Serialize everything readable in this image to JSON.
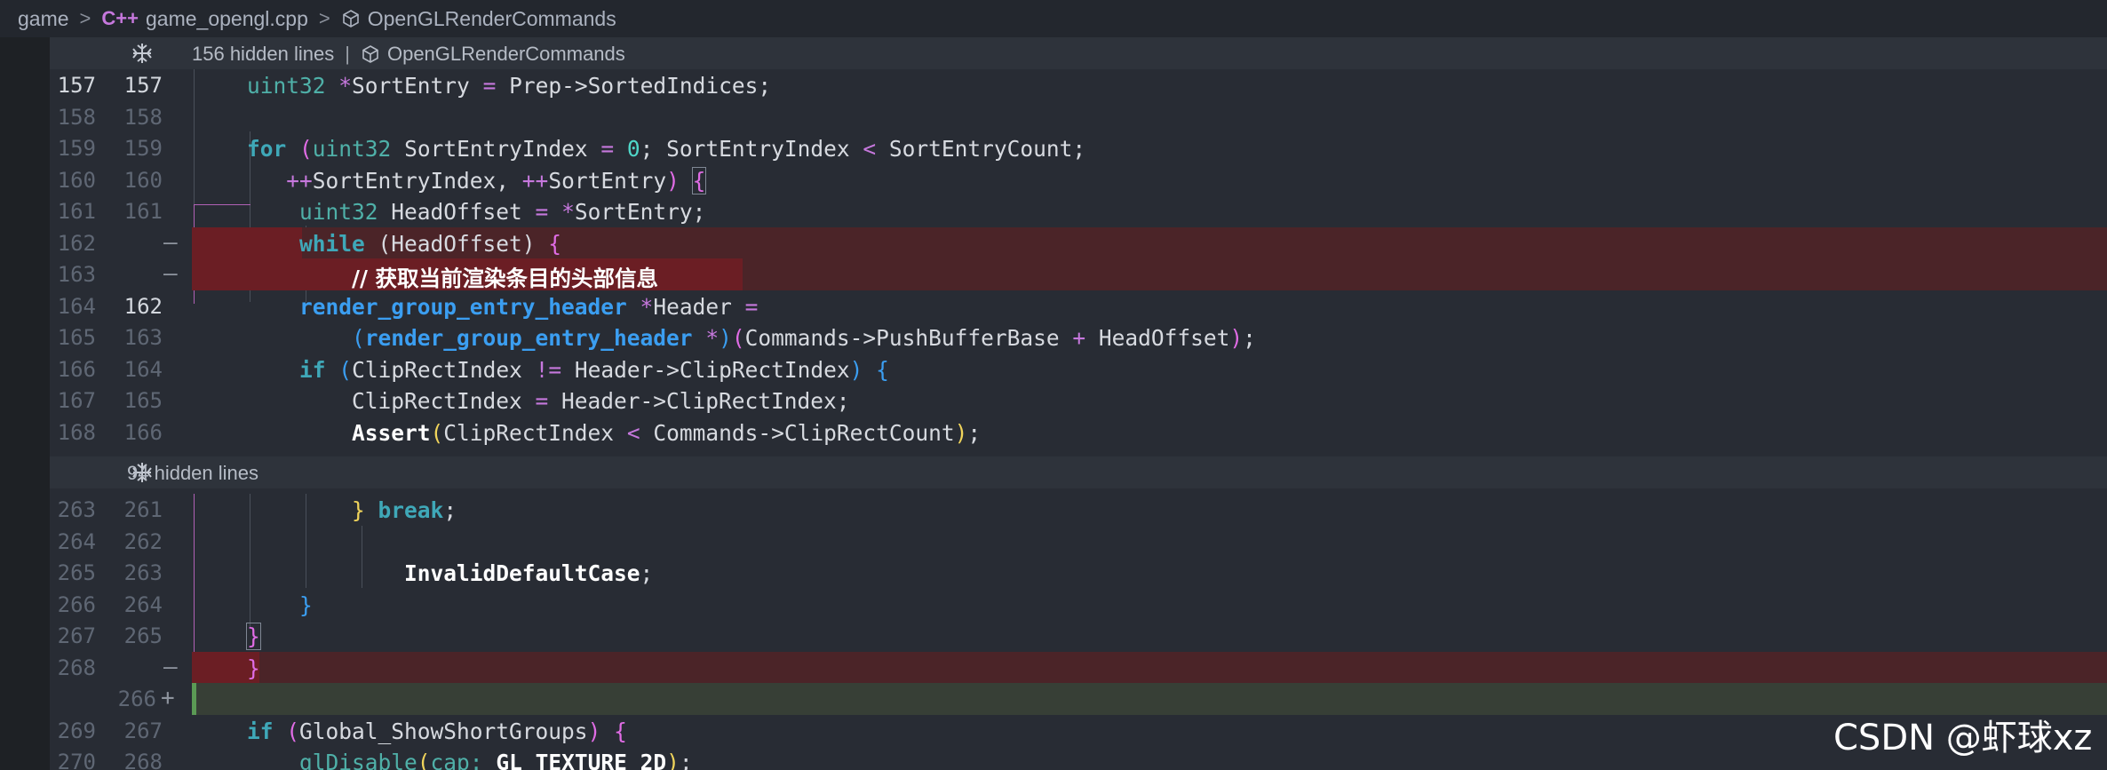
{
  "breadcrumb": {
    "root": "game",
    "file": "game_opengl.cpp",
    "symbol": "OpenGLRenderCommands",
    "file_icon": "C++"
  },
  "hidden_regions": [
    {
      "label": "156 hidden lines",
      "symbol": "OpenGLRenderCommands"
    },
    {
      "label": "94 hidden lines"
    }
  ],
  "lines": {
    "l157": {
      "old": "157",
      "new": "157"
    },
    "l158": {
      "old": "158",
      "new": "158"
    },
    "l159": {
      "old": "159",
      "new": "159"
    },
    "l160": {
      "old": "160",
      "new": "160"
    },
    "l161": {
      "old": "161",
      "new": "161"
    },
    "l162": {
      "old": "162",
      "mark": "—"
    },
    "l163": {
      "old": "163",
      "mark": "—"
    },
    "l164": {
      "old": "164",
      "new": "162"
    },
    "l165": {
      "old": "165",
      "new": "163"
    },
    "l166": {
      "old": "166",
      "new": "164"
    },
    "l167": {
      "old": "167",
      "new": "165"
    },
    "l168": {
      "old": "168",
      "new": "166"
    },
    "l263": {
      "old": "263",
      "new": "261"
    },
    "l264": {
      "old": "264",
      "new": "262"
    },
    "l265": {
      "old": "265",
      "new": "263"
    },
    "l266": {
      "old": "266",
      "new": "264"
    },
    "l267": {
      "old": "267",
      "new": "265"
    },
    "l268": {
      "old": "268",
      "mark": "—"
    },
    "add266": {
      "new": "266",
      "mark": "+"
    },
    "l269": {
      "old": "269",
      "new": "267"
    },
    "l270": {
      "old": "270",
      "new": "268"
    }
  },
  "watermark": "CSDN @虾球xz"
}
